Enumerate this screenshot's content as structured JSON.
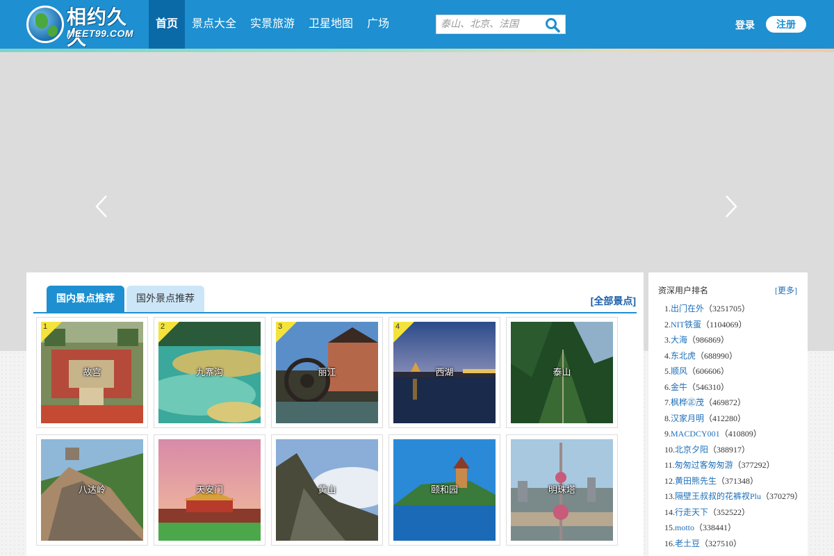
{
  "brand": {
    "logo_text": "相约久久",
    "logo_sub": "MEET99.COM"
  },
  "nav": [
    {
      "label": "首页",
      "active": true
    },
    {
      "label": "景点大全"
    },
    {
      "label": "实景旅游"
    },
    {
      "label": "卫星地图"
    },
    {
      "label": "广场"
    }
  ],
  "search": {
    "placeholder": "泰山、北京、法国",
    "icon": "search-icon"
  },
  "auth": {
    "login": "登录",
    "register": "注册"
  },
  "banner": {
    "prev_icon": "chevron-left-icon",
    "next_icon": "chevron-right-icon"
  },
  "tabs": [
    {
      "label": "国内景点推荐",
      "active": true
    },
    {
      "label": "国外景点推荐"
    }
  ],
  "all_link": "[全部景点]",
  "spots": [
    {
      "name": "故宫",
      "rank": "1"
    },
    {
      "name": "九寨沟",
      "rank": "2"
    },
    {
      "name": "丽江",
      "rank": "3"
    },
    {
      "name": "西湖",
      "rank": "4"
    },
    {
      "name": "泰山"
    },
    {
      "name": "八达岭"
    },
    {
      "name": "天安门"
    },
    {
      "name": "黄山"
    },
    {
      "name": "颐和园"
    },
    {
      "name": "明珠塔"
    }
  ],
  "sidebar": {
    "title": "资深用户排名",
    "more": "[更多]",
    "ranking": [
      {
        "idx": "1.",
        "name": "出门在外",
        "score": "（3251705）"
      },
      {
        "idx": "2.",
        "name": "NIT铁蛋",
        "score": "（1104069）"
      },
      {
        "idx": "3.",
        "name": "大海",
        "score": "（986869）"
      },
      {
        "idx": "4.",
        "name": "东北虎",
        "score": "（688990）"
      },
      {
        "idx": "5.",
        "name": "顺风",
        "score": "（606606）"
      },
      {
        "idx": "6.",
        "name": "金牛",
        "score": "（546310）"
      },
      {
        "idx": "7.",
        "name": "枫桦㊣茂",
        "score": "（469872）"
      },
      {
        "idx": "8.",
        "name": "汉家月明",
        "score": "（412280）"
      },
      {
        "idx": "9.",
        "name": "MACDCY001",
        "score": "（410809）"
      },
      {
        "idx": "10.",
        "name": "北京夕阳",
        "score": "（388917）"
      },
      {
        "idx": "11.",
        "name": "匆匆过客匆匆游",
        "score": "（377292）"
      },
      {
        "idx": "12.",
        "name": "黄田熊先生",
        "score": "（371348）"
      },
      {
        "idx": "13.",
        "name": "隔壁王叔叔的花裤衩Plu",
        "score": "（370279）"
      },
      {
        "idx": "14.",
        "name": "行走天下",
        "score": "（352522）"
      },
      {
        "idx": "15.",
        "name": "motto",
        "score": "（338441）"
      },
      {
        "idx": "16.",
        "name": "老土豆",
        "score": "（327510）"
      }
    ]
  }
}
